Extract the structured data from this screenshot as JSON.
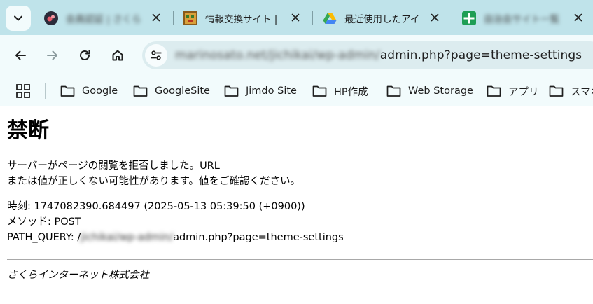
{
  "tabs": [
    {
      "title": "会員認証 | さくら",
      "blurred": true
    },
    {
      "title": "情報交換サイト |",
      "blurred": false
    },
    {
      "title": "最近使用したアイ",
      "blurred": false
    },
    {
      "title": "自治会サイト一覧",
      "blurred": true
    }
  ],
  "omnibox": {
    "url_hidden": "marinosato.net/jichikai/wp-admin/",
    "url_visible": "admin.php?page=theme-settings"
  },
  "bookmarks": [
    {
      "label": "Google"
    },
    {
      "label": "GoogleSite"
    },
    {
      "label": "Jimdo Site"
    },
    {
      "label": "HP作成"
    },
    {
      "label": "Web Storage"
    },
    {
      "label": "アプリ"
    },
    {
      "label": "スマホ"
    }
  ],
  "page": {
    "title": "禁断",
    "message_line1": "サーバーがページの閲覧を拒否しました。URL",
    "message_line2": "または値が正しくない可能性があります。値をご確認ください。",
    "time_line": "時刻: 1747082390.684497 (2025-05-13 05:39:50 (+0900))",
    "method_line": "メソッド: POST",
    "path_label": "PATH_QUERY: /",
    "path_hidden": "jichikai/wp-admin/",
    "path_visible": "admin.php?page=theme-settings",
    "footer": "さくらインターネット株式会社"
  },
  "colors": {
    "tabstrip_bg": "#bfe3ea",
    "toolbar_bg": "#f2fbfc",
    "omnibox_bg": "#dcecef"
  }
}
